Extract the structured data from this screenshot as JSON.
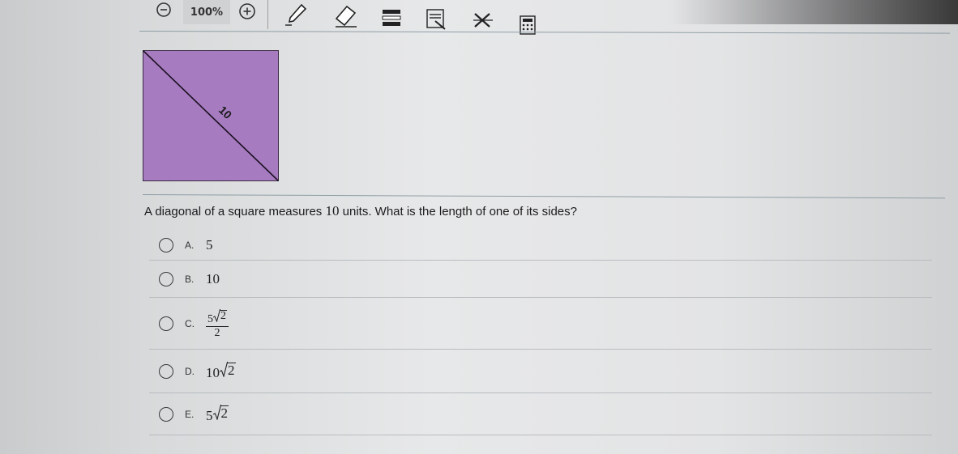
{
  "toolbar": {
    "zoom_level": "100%",
    "icons": [
      "zoom-out-icon",
      "zoom-in-icon",
      "pen-icon",
      "eraser-icon",
      "highlighter-icon",
      "line-reader-icon",
      "answer-eliminator-icon",
      "calculator-icon"
    ]
  },
  "figure": {
    "diagonal_label": "10",
    "fill_color": "#a77bc0"
  },
  "question": {
    "prefix": "A diagonal of a square measures ",
    "number": "10",
    "suffix": " units. What is the length of one of its sides?"
  },
  "choices": [
    {
      "letter": "A.",
      "value": "5"
    },
    {
      "letter": "B.",
      "value": "10"
    },
    {
      "letter": "C.",
      "numerator_coef": "5",
      "radicand": "2",
      "denominator": "2"
    },
    {
      "letter": "D.",
      "coef": "10",
      "radicand": "2"
    },
    {
      "letter": "E.",
      "coef": "5",
      "radicand": "2"
    }
  ]
}
